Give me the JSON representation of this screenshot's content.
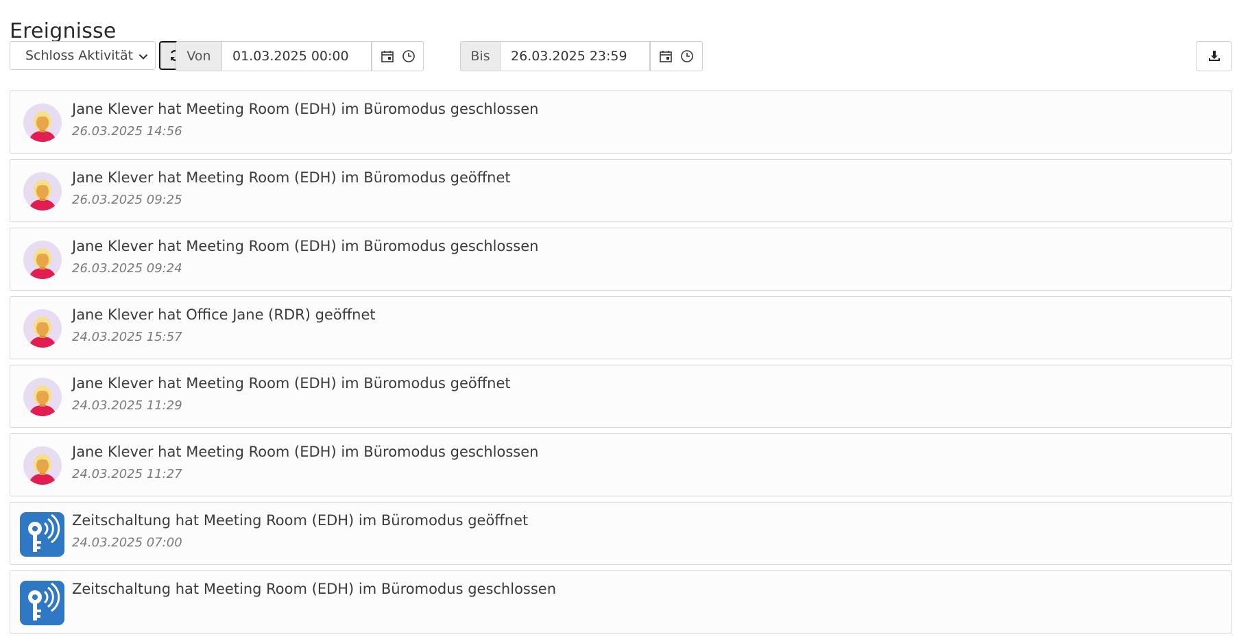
{
  "page": {
    "title": "Ereignisse"
  },
  "filter": {
    "type_selected": "Schloss Aktivität",
    "from_label": "Von",
    "from_value": "01.03.2025 00:00",
    "to_label": "Bis",
    "to_value": "26.03.2025 23:59"
  },
  "events": [
    {
      "actor": "user",
      "text": "Jane Klever hat Meeting Room (EDH) im Büromodus geschlossen",
      "time": "26.03.2025 14:56"
    },
    {
      "actor": "user",
      "text": "Jane Klever hat Meeting Room (EDH) im Büromodus geöffnet",
      "time": "26.03.2025 09:25"
    },
    {
      "actor": "user",
      "text": "Jane Klever hat Meeting Room (EDH) im Büromodus geschlossen",
      "time": "26.03.2025 09:24"
    },
    {
      "actor": "user",
      "text": "Jane Klever hat Office Jane (RDR) geöffnet",
      "time": "24.03.2025 15:57"
    },
    {
      "actor": "user",
      "text": "Jane Klever hat Meeting Room (EDH) im Büromodus geöffnet",
      "time": "24.03.2025 11:29"
    },
    {
      "actor": "user",
      "text": "Jane Klever hat Meeting Room (EDH) im Büromodus geschlossen",
      "time": "24.03.2025 11:27"
    },
    {
      "actor": "system",
      "text": "Zeitschaltung hat Meeting Room (EDH) im Büromodus geöffnet",
      "time": "24.03.2025 07:00"
    },
    {
      "actor": "system",
      "text": "Zeitschaltung hat Meeting Room (EDH) im Büromodus geschlossen",
      "time": ""
    }
  ],
  "icons": {
    "refresh": "refresh-icon",
    "calendar": "calendar-icon",
    "clock": "clock-icon",
    "download": "download-icon",
    "user_avatar": "female-user-avatar",
    "system": "key-wireless-icon"
  },
  "colors": {
    "avatar_bg": "#e8dcf2",
    "system_icon_bg": "#2f78c4"
  }
}
